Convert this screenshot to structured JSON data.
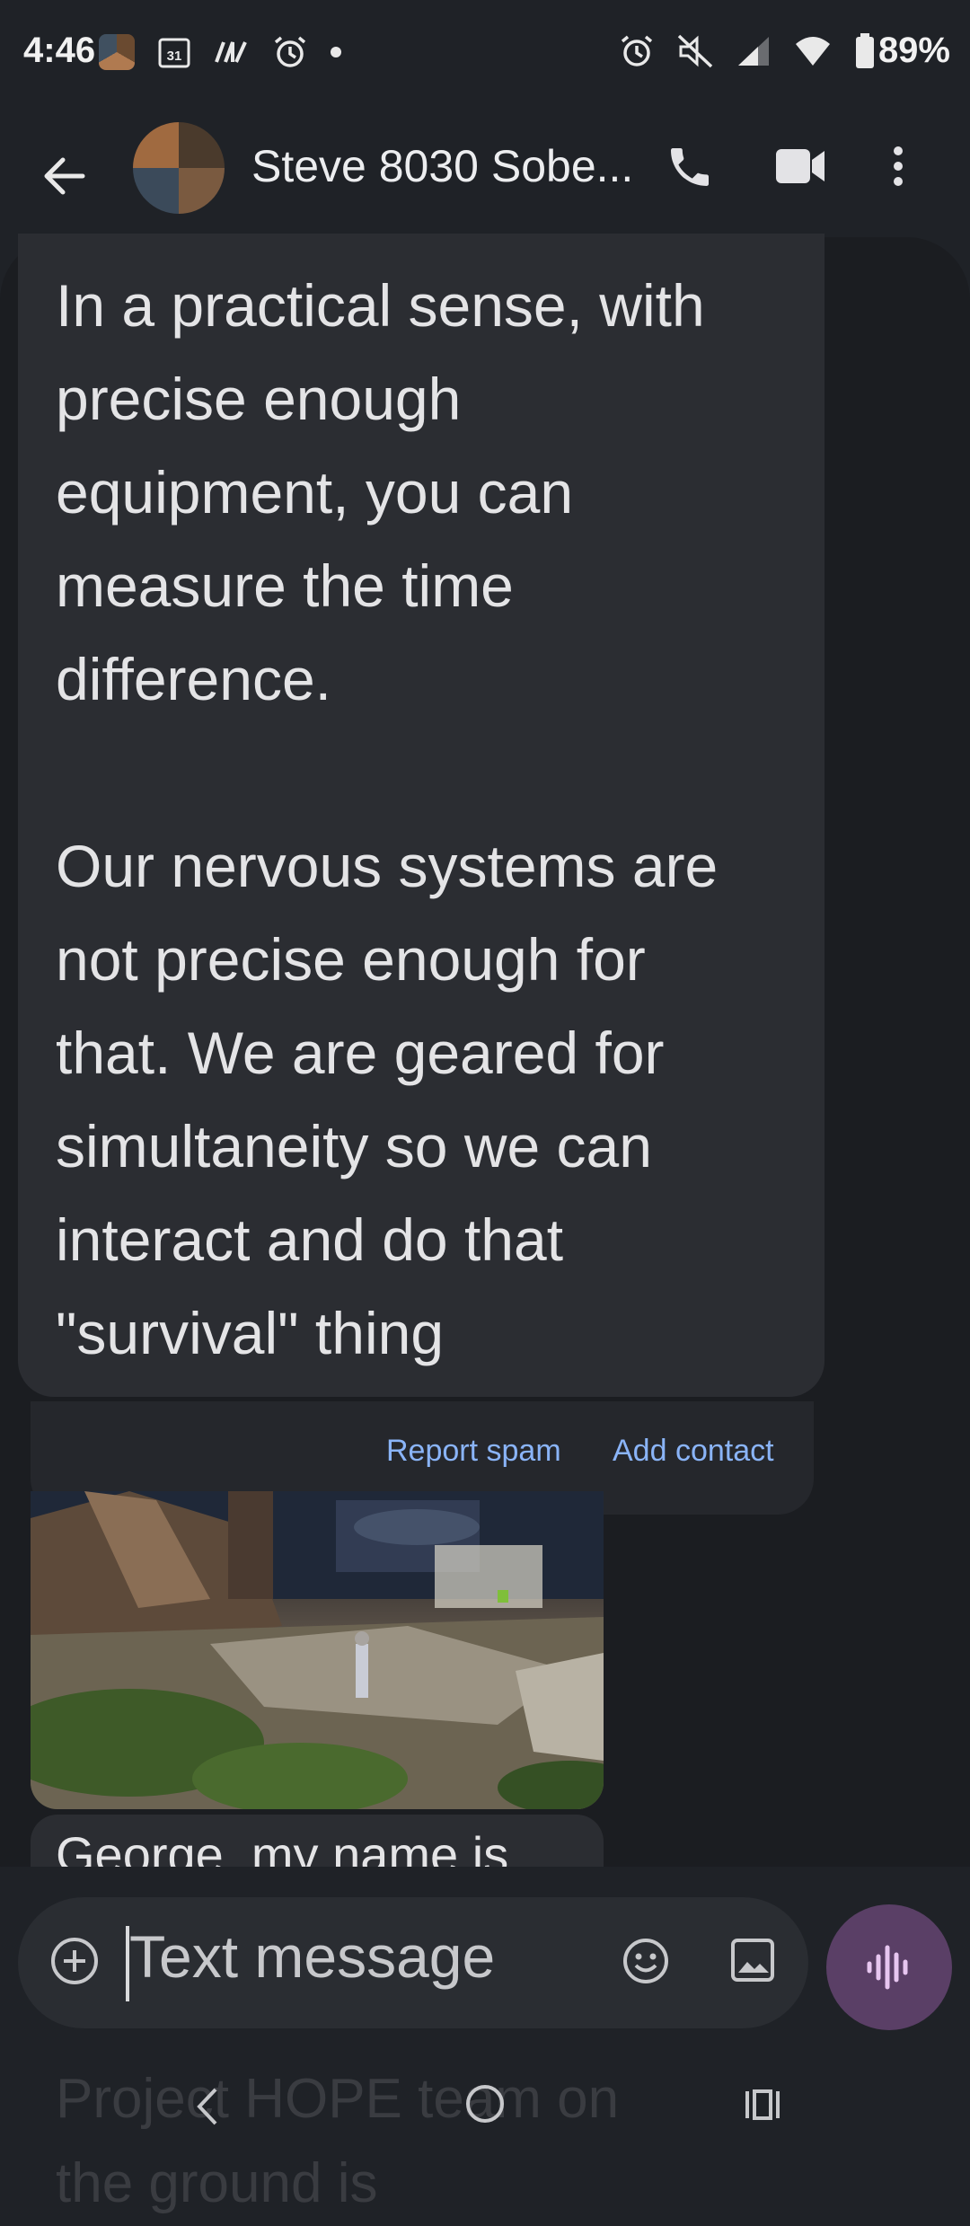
{
  "status_bar": {
    "time": "4:46",
    "calendar_day": "31",
    "battery": "89%"
  },
  "header": {
    "title": "Steve 8030 Sobe..."
  },
  "messages": {
    "main_text": "In a practical sense, with\nprecise enough\nequipment, you can\nmeasure the time\ndifference.\n\nOur nervous systems are\nnot precise enough for\nthat. We are geared for\nsimultaneity so we can\ninteract and do that\n\"survival\" thing",
    "george_text": "George, my name is"
  },
  "spam_bar": {
    "report_label": "Report spam",
    "add_label": "Add contact"
  },
  "compose": {
    "placeholder": "Text message"
  },
  "faded_text": "Project HOPE team on\nthe ground is",
  "colors": {
    "accent_link": "#8ab4f8",
    "voice_button": "#5a3f66",
    "bubble": "#2b2d32"
  }
}
